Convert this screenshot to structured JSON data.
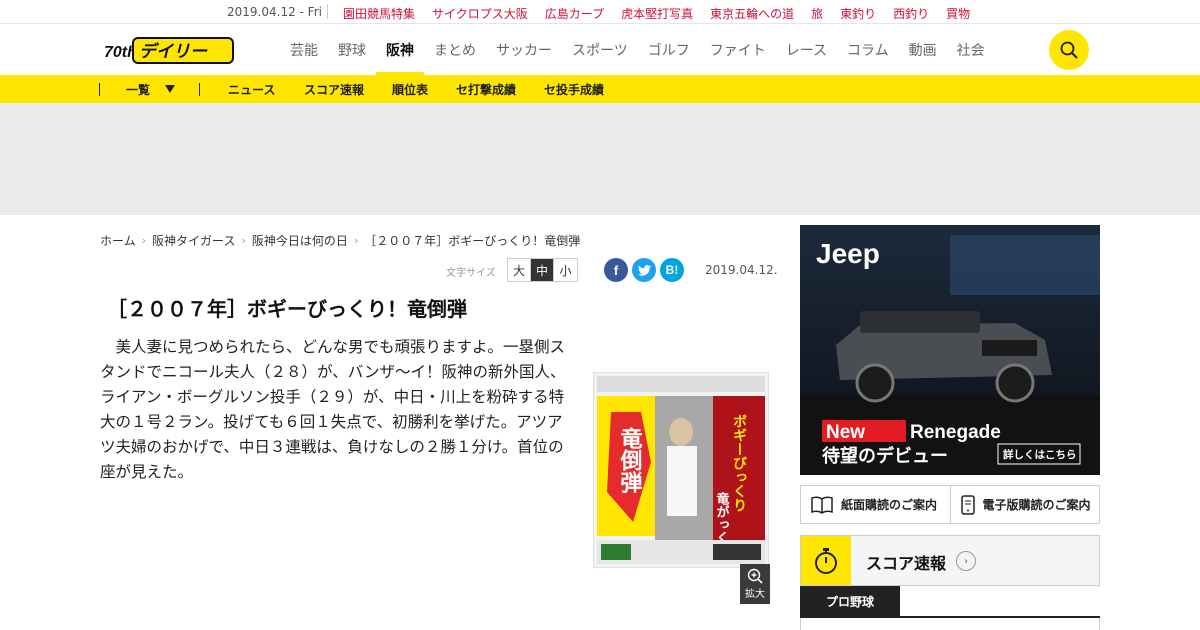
{
  "topbar": {
    "date": "2019.04.12 - Fri",
    "links": [
      "園田競馬特集",
      "サイクロプス大阪",
      "広島カープ",
      "虎本堅打写真",
      "東京五輪への道",
      "旅",
      "東釣り",
      "西釣り",
      "買物"
    ]
  },
  "header": {
    "logo_text": "デイリー",
    "logo_badge": "70th",
    "nav": [
      "芸能",
      "野球",
      "阪神",
      "まとめ",
      "サッカー",
      "スポーツ",
      "ゴルフ",
      "ファイト",
      "レース",
      "コラム",
      "動画",
      "社会"
    ],
    "active_nav": "阪神"
  },
  "subnav": {
    "list_label": "一覧",
    "items": [
      "ニュース",
      "スコア速報",
      "順位表",
      "セ打撃成績",
      "セ投手成績"
    ]
  },
  "breadcrumb": [
    "ホーム",
    "阪神タイガース",
    "阪神今日は何の日",
    "［２００７年］ボギーびっくり！竜倒弾"
  ],
  "tools": {
    "font_size_label": "文字サイズ",
    "font_sizes": [
      "大",
      "中",
      "小"
    ],
    "selected_size": "中",
    "date": "2019.04.12."
  },
  "article": {
    "title": "［２００７年］ボギーびっくり！竜倒弾",
    "body": "美人妻に見つめられたら、どんな男でも頑張りますよ。一塁側スタンドでニコール夫人（２８）が、バンザ～イ！阪神の新外国人、ライアン・ボーグルソン投手（２９）が、中日・川上を粉砕する特大の１号２ラン。投げても６回１失点で、初勝利を挙げた。アツアツ夫婦のおかげで、中日３連戦は、負けなしの２勝１分け。首位の座が見えた。",
    "zoom_label": "拡大",
    "paper_headline": "ボギーびっくり",
    "paper_headline2": "竜倒弾",
    "paper_headline3": "竜がっくり"
  },
  "sidebar": {
    "ad": {
      "brand": "Jeep",
      "new_label": "New",
      "model": "Renegade",
      "tagline": "待望のデビュー",
      "cta": "詳しくはこちら"
    },
    "subscribe": [
      "紙面購読のご案内",
      "電子版購読のご案内"
    ],
    "score": {
      "title": "スコア速報",
      "tab": "プロ野球"
    }
  },
  "colors": {
    "accent_yellow": "#ffe600",
    "link_red": "#d0103a",
    "facebook": "#3b5998",
    "twitter": "#1da1f2",
    "hatena": "#00a4de"
  }
}
